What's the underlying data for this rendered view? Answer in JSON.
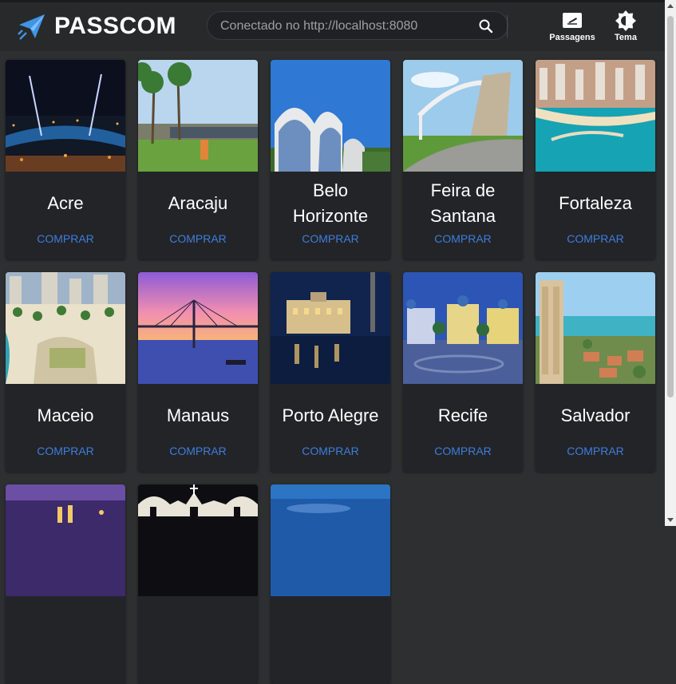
{
  "header": {
    "brand": "PASSCOM",
    "search_placeholder": "Conectado no http://localhost:8080",
    "nav": [
      {
        "label": "Passagens",
        "icon": "ticket-icon"
      },
      {
        "label": "Tema",
        "icon": "brightness-icon"
      }
    ]
  },
  "cities": [
    {
      "name": "Acre",
      "action": "COMPRAR"
    },
    {
      "name": "Aracaju",
      "action": "COMPRAR"
    },
    {
      "name": "Belo Horizonte",
      "action": "COMPRAR"
    },
    {
      "name": "Feira de Santana",
      "action": "COMPRAR"
    },
    {
      "name": "Fortaleza",
      "action": "COMPRAR"
    },
    {
      "name": "Maceio",
      "action": "COMPRAR"
    },
    {
      "name": "Manaus",
      "action": "COMPRAR"
    },
    {
      "name": "Porto Alegre",
      "action": "COMPRAR"
    },
    {
      "name": "Recife",
      "action": "COMPRAR"
    },
    {
      "name": "Salvador",
      "action": "COMPRAR"
    }
  ],
  "colors": {
    "background": "#2e2f31",
    "card": "#232427",
    "accent": "#3d7ddd"
  }
}
